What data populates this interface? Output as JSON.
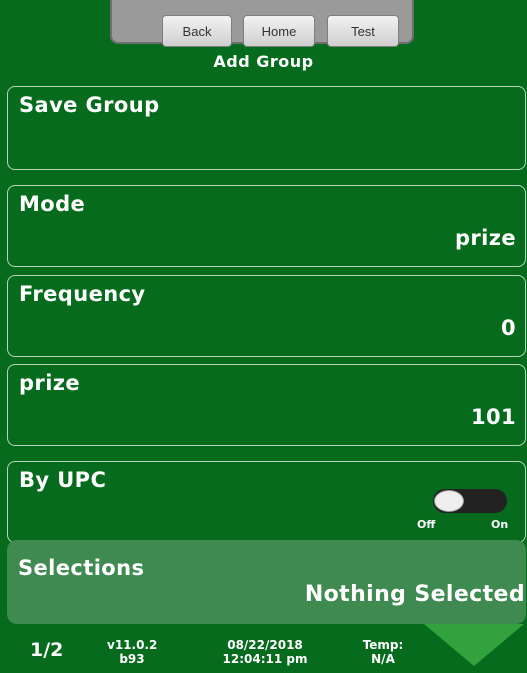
{
  "nav": {
    "back": "Back",
    "home": "Home",
    "test": "Test"
  },
  "page_title": "Add Group",
  "rows": {
    "save": {
      "label": "Save Group"
    },
    "mode": {
      "label": "Mode",
      "value": "prize"
    },
    "frequency": {
      "label": "Frequency",
      "value": "0"
    },
    "prize": {
      "label": "prize",
      "value": "101"
    },
    "by_upc": {
      "label": "By UPC",
      "off": "Off",
      "on": "On",
      "state": "off"
    }
  },
  "selections": {
    "label": "Selections",
    "value": "Nothing Selected"
  },
  "footer": {
    "page": "1/2",
    "version": "v11.0.2",
    "build": "b93",
    "date": "08/22/2018",
    "time": "12:04:11 pm",
    "temp_label": "Temp:",
    "temp_value": "N/A"
  },
  "colors": {
    "background": "#076b1e",
    "selections_bg": "#3e8a50",
    "arrow": "#32a23c",
    "row_border": "#b7d4bd"
  },
  "icons": {
    "next_page": "triangle-down-icon"
  }
}
